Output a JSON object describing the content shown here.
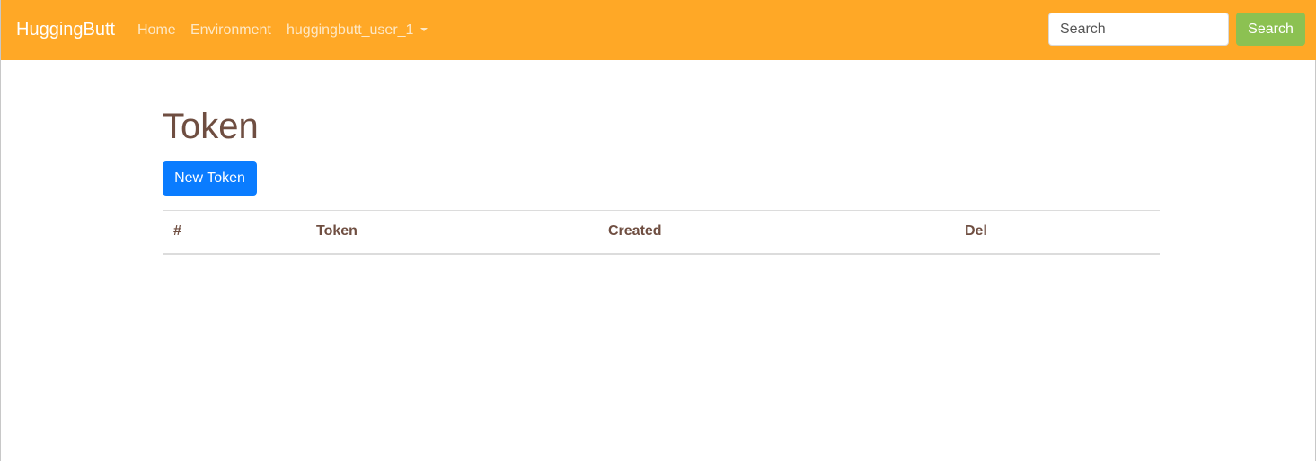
{
  "navbar": {
    "brand": "HuggingButt",
    "links": [
      {
        "label": "Home"
      },
      {
        "label": "Environment"
      },
      {
        "label": "huggingbutt_user_1"
      }
    ],
    "search": {
      "placeholder": "Search",
      "value": "",
      "button_label": "Search"
    }
  },
  "main": {
    "title": "Token",
    "new_token_label": "New Token",
    "table": {
      "headers": [
        "#",
        "Token",
        "Created",
        "Del"
      ],
      "rows": []
    }
  },
  "colors": {
    "navbar": "#ffa826",
    "search_button": "#8cc152",
    "primary_button": "#0a7cff",
    "heading_text": "#6f4e41"
  }
}
